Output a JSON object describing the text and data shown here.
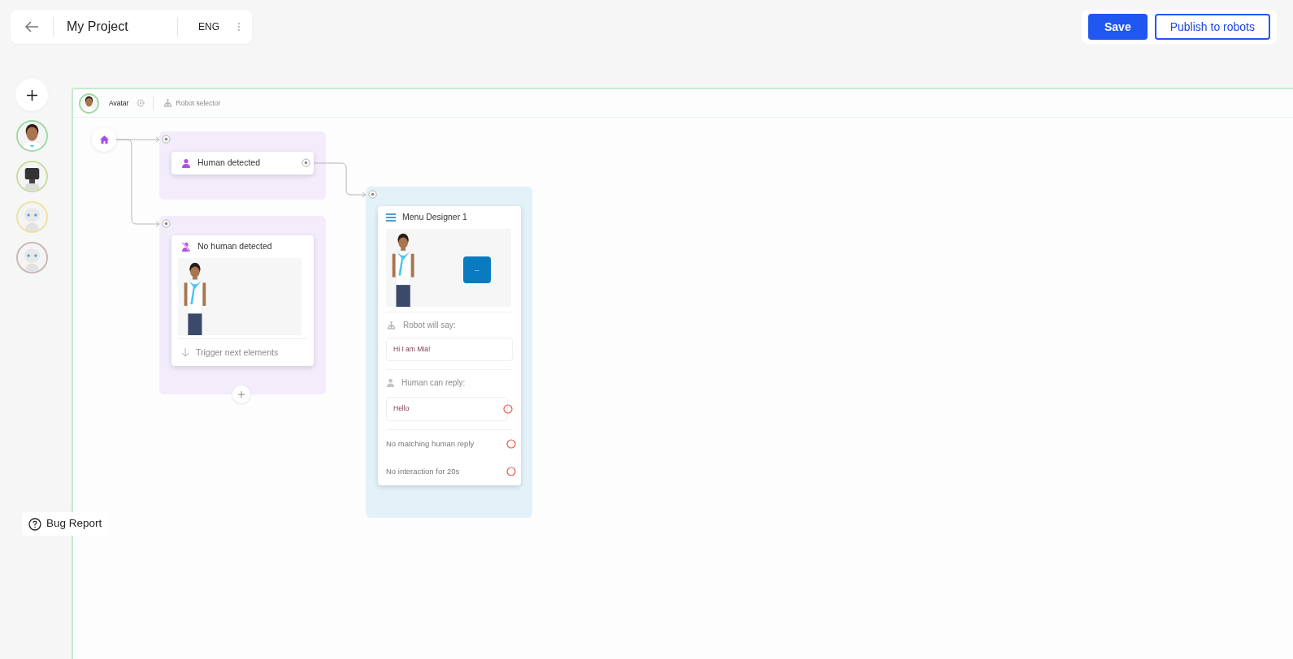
{
  "header": {
    "title": "My Project",
    "language": "ENG"
  },
  "actions": [
    {
      "label": "Save",
      "kind": "primary"
    },
    {
      "label": "Publish to robots",
      "kind": "outline"
    }
  ],
  "robots": [
    {
      "color": "#9ed9a6",
      "kind": "avatar"
    },
    {
      "color": "#c9dc9a",
      "kind": "screen"
    },
    {
      "color": "#eee39a",
      "kind": "round"
    },
    {
      "color": "#c9b6b0",
      "kind": "round"
    }
  ],
  "canvas": {
    "toolbar": {
      "avatar_label": "Avatar",
      "robot_selector": "Robot selector"
    },
    "nodes": [
      {
        "kind": "trigger",
        "title": "Human detected"
      },
      {
        "kind": "trigger",
        "title": "No human detected",
        "footer": "Trigger next elements"
      },
      {
        "kind": "menu",
        "title": "Menu Designer 1",
        "button_label": "--",
        "robot_says_label": "Robot will say:",
        "robot_says": "Hi I am Mia!",
        "human_reply_label": "Human can reply:",
        "replies": [
          "Hello"
        ],
        "outcomes": [
          "No matching human reply",
          "No interaction for 20s"
        ]
      }
    ]
  },
  "bug_report": "Bug Report"
}
